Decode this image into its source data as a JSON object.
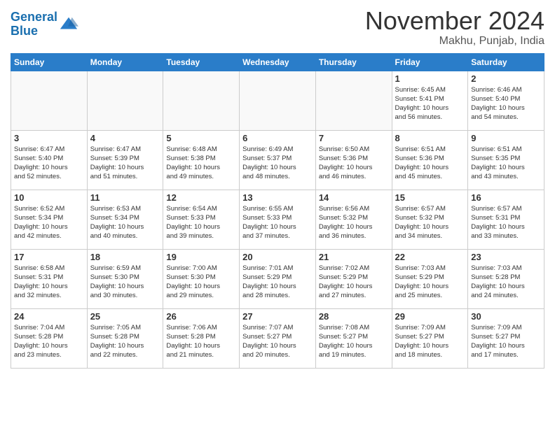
{
  "header": {
    "logo_line1": "General",
    "logo_line2": "Blue",
    "month": "November 2024",
    "location": "Makhu, Punjab, India"
  },
  "weekdays": [
    "Sunday",
    "Monday",
    "Tuesday",
    "Wednesday",
    "Thursday",
    "Friday",
    "Saturday"
  ],
  "weeks": [
    [
      {
        "day": "",
        "info": ""
      },
      {
        "day": "",
        "info": ""
      },
      {
        "day": "",
        "info": ""
      },
      {
        "day": "",
        "info": ""
      },
      {
        "day": "",
        "info": ""
      },
      {
        "day": "1",
        "info": "Sunrise: 6:45 AM\nSunset: 5:41 PM\nDaylight: 10 hours\nand 56 minutes."
      },
      {
        "day": "2",
        "info": "Sunrise: 6:46 AM\nSunset: 5:40 PM\nDaylight: 10 hours\nand 54 minutes."
      }
    ],
    [
      {
        "day": "3",
        "info": "Sunrise: 6:47 AM\nSunset: 5:40 PM\nDaylight: 10 hours\nand 52 minutes."
      },
      {
        "day": "4",
        "info": "Sunrise: 6:47 AM\nSunset: 5:39 PM\nDaylight: 10 hours\nand 51 minutes."
      },
      {
        "day": "5",
        "info": "Sunrise: 6:48 AM\nSunset: 5:38 PM\nDaylight: 10 hours\nand 49 minutes."
      },
      {
        "day": "6",
        "info": "Sunrise: 6:49 AM\nSunset: 5:37 PM\nDaylight: 10 hours\nand 48 minutes."
      },
      {
        "day": "7",
        "info": "Sunrise: 6:50 AM\nSunset: 5:36 PM\nDaylight: 10 hours\nand 46 minutes."
      },
      {
        "day": "8",
        "info": "Sunrise: 6:51 AM\nSunset: 5:36 PM\nDaylight: 10 hours\nand 45 minutes."
      },
      {
        "day": "9",
        "info": "Sunrise: 6:51 AM\nSunset: 5:35 PM\nDaylight: 10 hours\nand 43 minutes."
      }
    ],
    [
      {
        "day": "10",
        "info": "Sunrise: 6:52 AM\nSunset: 5:34 PM\nDaylight: 10 hours\nand 42 minutes."
      },
      {
        "day": "11",
        "info": "Sunrise: 6:53 AM\nSunset: 5:34 PM\nDaylight: 10 hours\nand 40 minutes."
      },
      {
        "day": "12",
        "info": "Sunrise: 6:54 AM\nSunset: 5:33 PM\nDaylight: 10 hours\nand 39 minutes."
      },
      {
        "day": "13",
        "info": "Sunrise: 6:55 AM\nSunset: 5:33 PM\nDaylight: 10 hours\nand 37 minutes."
      },
      {
        "day": "14",
        "info": "Sunrise: 6:56 AM\nSunset: 5:32 PM\nDaylight: 10 hours\nand 36 minutes."
      },
      {
        "day": "15",
        "info": "Sunrise: 6:57 AM\nSunset: 5:32 PM\nDaylight: 10 hours\nand 34 minutes."
      },
      {
        "day": "16",
        "info": "Sunrise: 6:57 AM\nSunset: 5:31 PM\nDaylight: 10 hours\nand 33 minutes."
      }
    ],
    [
      {
        "day": "17",
        "info": "Sunrise: 6:58 AM\nSunset: 5:31 PM\nDaylight: 10 hours\nand 32 minutes."
      },
      {
        "day": "18",
        "info": "Sunrise: 6:59 AM\nSunset: 5:30 PM\nDaylight: 10 hours\nand 30 minutes."
      },
      {
        "day": "19",
        "info": "Sunrise: 7:00 AM\nSunset: 5:30 PM\nDaylight: 10 hours\nand 29 minutes."
      },
      {
        "day": "20",
        "info": "Sunrise: 7:01 AM\nSunset: 5:29 PM\nDaylight: 10 hours\nand 28 minutes."
      },
      {
        "day": "21",
        "info": "Sunrise: 7:02 AM\nSunset: 5:29 PM\nDaylight: 10 hours\nand 27 minutes."
      },
      {
        "day": "22",
        "info": "Sunrise: 7:03 AM\nSunset: 5:29 PM\nDaylight: 10 hours\nand 25 minutes."
      },
      {
        "day": "23",
        "info": "Sunrise: 7:03 AM\nSunset: 5:28 PM\nDaylight: 10 hours\nand 24 minutes."
      }
    ],
    [
      {
        "day": "24",
        "info": "Sunrise: 7:04 AM\nSunset: 5:28 PM\nDaylight: 10 hours\nand 23 minutes."
      },
      {
        "day": "25",
        "info": "Sunrise: 7:05 AM\nSunset: 5:28 PM\nDaylight: 10 hours\nand 22 minutes."
      },
      {
        "day": "26",
        "info": "Sunrise: 7:06 AM\nSunset: 5:28 PM\nDaylight: 10 hours\nand 21 minutes."
      },
      {
        "day": "27",
        "info": "Sunrise: 7:07 AM\nSunset: 5:27 PM\nDaylight: 10 hours\nand 20 minutes."
      },
      {
        "day": "28",
        "info": "Sunrise: 7:08 AM\nSunset: 5:27 PM\nDaylight: 10 hours\nand 19 minutes."
      },
      {
        "day": "29",
        "info": "Sunrise: 7:09 AM\nSunset: 5:27 PM\nDaylight: 10 hours\nand 18 minutes."
      },
      {
        "day": "30",
        "info": "Sunrise: 7:09 AM\nSunset: 5:27 PM\nDaylight: 10 hours\nand 17 minutes."
      }
    ]
  ]
}
